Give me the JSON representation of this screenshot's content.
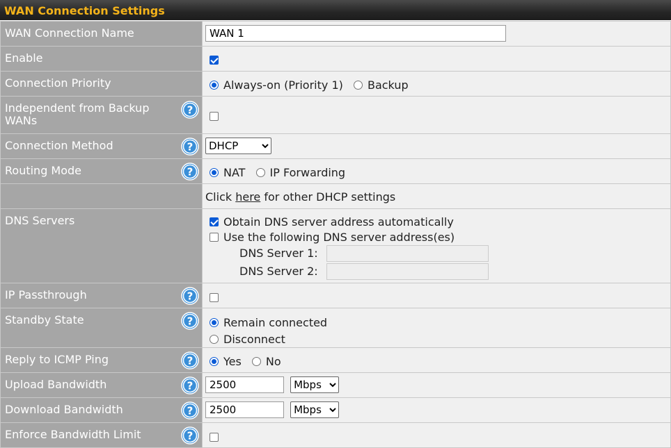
{
  "header": {
    "title": "WAN Connection Settings"
  },
  "rows": {
    "name": {
      "label": "WAN Connection Name",
      "value": "WAN 1"
    },
    "enable": {
      "label": "Enable"
    },
    "priority": {
      "label": "Connection Priority",
      "opt1": "Always-on (Priority 1)",
      "opt2": "Backup"
    },
    "independent": {
      "label": "Independent from Backup WANs"
    },
    "method": {
      "label": "Connection Method",
      "selected": "DHCP"
    },
    "routing": {
      "label": "Routing Mode",
      "opt1": "NAT",
      "opt2": "IP Forwarding"
    },
    "dhcp": {
      "pre": "Click ",
      "link": "here",
      "post": " for other DHCP settings"
    },
    "dns": {
      "label": "DNS Servers",
      "opt1": "Obtain DNS server address automatically",
      "opt2": "Use the following DNS server address(es)",
      "server1_label": "DNS Server 1:",
      "server2_label": "DNS Server 2:"
    },
    "passthrough": {
      "label": "IP Passthrough"
    },
    "standby": {
      "label": "Standby State",
      "opt1": "Remain connected",
      "opt2": "Disconnect"
    },
    "icmp": {
      "label": "Reply to ICMP Ping",
      "opt1": "Yes",
      "opt2": "No"
    },
    "upload": {
      "label": "Upload Bandwidth",
      "value": "2500",
      "unit": "Mbps"
    },
    "download": {
      "label": "Download Bandwidth",
      "value": "2500",
      "unit": "Mbps"
    },
    "enforce": {
      "label": "Enforce Bandwidth Limit"
    }
  },
  "icons": {
    "help": "help-question-icon"
  },
  "colors": {
    "header_text": "#f4b31a",
    "label_bg": "#a6a6a6",
    "value_bg": "#f0f0f0",
    "accent": "#0a5ad6"
  }
}
